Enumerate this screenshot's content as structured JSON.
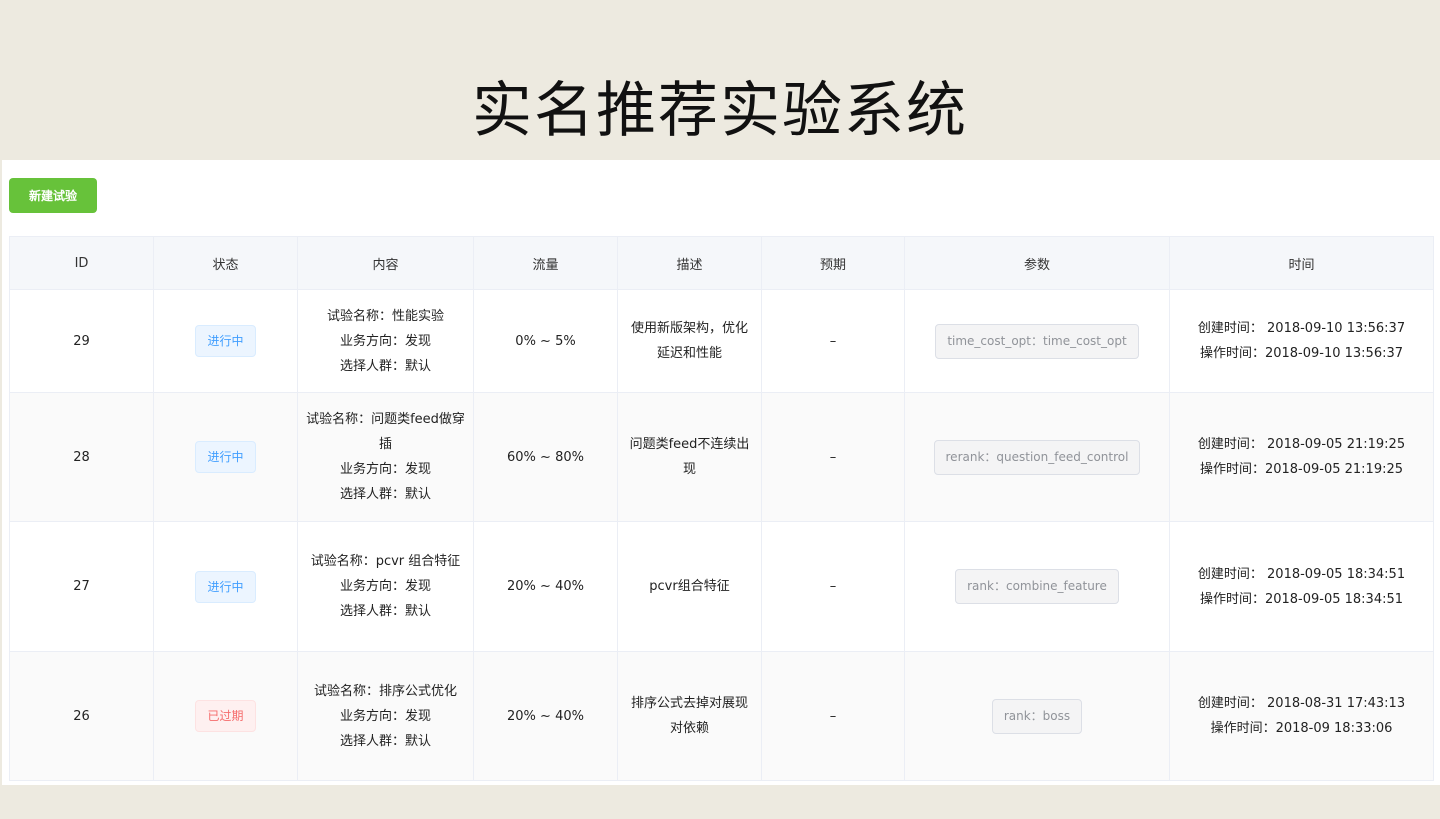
{
  "title": "实名推荐实验系统",
  "new_button": "新建试验",
  "columns": [
    "ID",
    "状态",
    "内容",
    "流量",
    "描述",
    "预期",
    "参数",
    "时间"
  ],
  "rows": [
    {
      "id": "29",
      "status": "进行中",
      "status_type": "running",
      "name": "试验名称：性能实验",
      "direction": "业务方向：发现",
      "crowd": "选择人群：默认",
      "traffic": "0% ~ 5%",
      "desc": "使用新版架构，优化延迟和性能",
      "expect": "–",
      "param": "time_cost_opt：time_cost_opt",
      "created": "创建时间： 2018-09-10 13:56:37",
      "operated": "操作时间：2018-09-10 13:56:37"
    },
    {
      "id": "28",
      "status": "进行中",
      "status_type": "running",
      "name": "试验名称：问题类feed做穿插",
      "direction": "业务方向：发现",
      "crowd": "选择人群：默认",
      "traffic": "60% ~ 80%",
      "desc": "问题类feed不连续出现",
      "expect": "–",
      "param": "rerank：question_feed_control",
      "created": "创建时间： 2018-09-05 21:19:25",
      "operated": "操作时间：2018-09-05 21:19:25"
    },
    {
      "id": "27",
      "status": "进行中",
      "status_type": "running",
      "name": "试验名称：pcvr 组合特征",
      "direction": "业务方向：发现",
      "crowd": "选择人群：默认",
      "traffic": "20% ~ 40%",
      "desc": "pcvr组合特征",
      "expect": "–",
      "param": "rank：combine_feature",
      "created": "创建时间： 2018-09-05 18:34:51",
      "operated": "操作时间：2018-09-05 18:34:51"
    },
    {
      "id": "26",
      "status": "已过期",
      "status_type": "expired",
      "name": "试验名称：排序公式优化",
      "direction": "业务方向：发现",
      "crowd": "选择人群：默认",
      "traffic": "20% ~ 40%",
      "desc": "排序公式去掉对展现对依赖",
      "expect": "–",
      "param": "rank：boss",
      "created": "创建时间： 2018-08-31 17:43:13",
      "operated": "操作时间：2018-09 18:33:06"
    }
  ]
}
